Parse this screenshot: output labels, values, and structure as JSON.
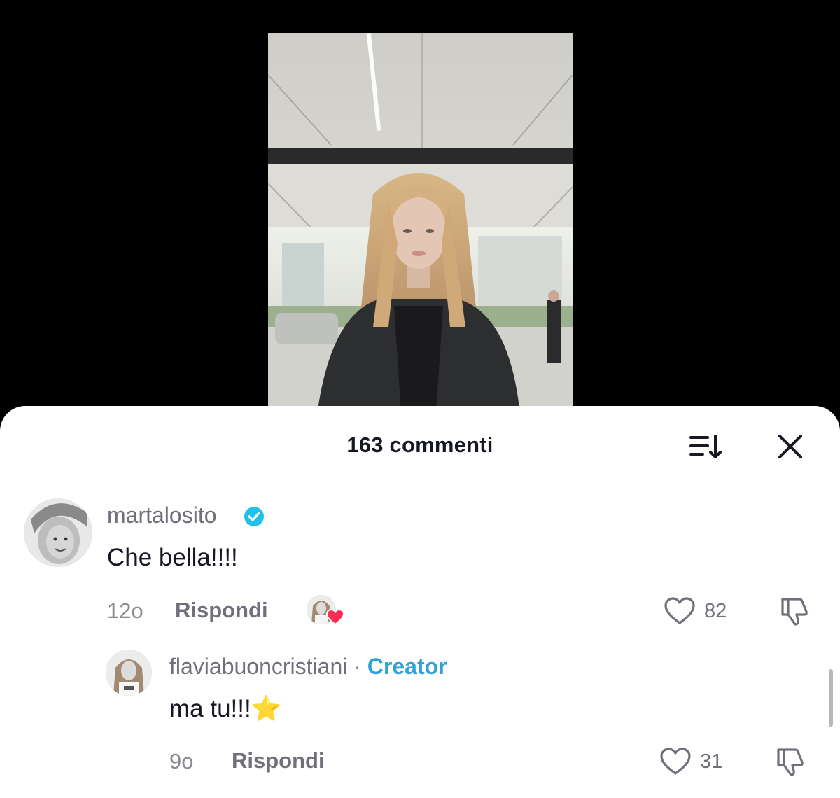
{
  "header": {
    "comment_count_label": "163 commenti",
    "sort_icon": "sort-icon",
    "close_icon": "close-icon"
  },
  "comments": [
    {
      "username": "martalosito",
      "verified": true,
      "text": "Che bella!!!!",
      "time": "12o",
      "reply_label": "Rispondi",
      "liked_by_creator": true,
      "likes": "82"
    },
    {
      "username": "flaviabuoncristiani",
      "separator": "·",
      "badge": "Creator",
      "text": "ma tu!!!",
      "emoji": "⭐",
      "time": "9o",
      "reply_label": "Rispondi",
      "likes": "31"
    }
  ],
  "colors": {
    "accent_creator": "#2fa3d6",
    "verified_badge": "#20c1e8",
    "heart_red": "#fe2c55"
  }
}
